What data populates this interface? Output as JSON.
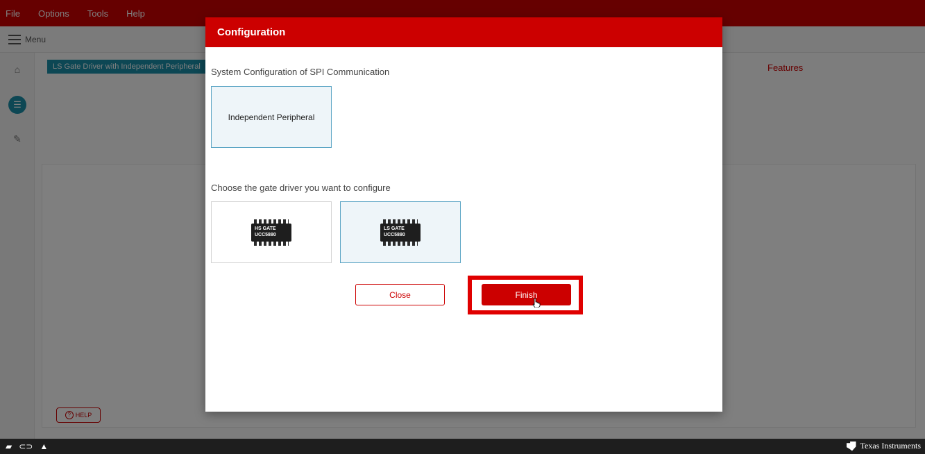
{
  "menubar": {
    "items": [
      "File",
      "Options",
      "Tools",
      "Help"
    ]
  },
  "toolbar": {
    "menu_label": "Menu"
  },
  "content": {
    "device_tab": "LS Gate Driver with Independent Peripheral",
    "features_tab": "Features",
    "help_label": "HELP"
  },
  "dialog": {
    "title": "Configuration",
    "section1_label": "System Configuration of SPI Communication",
    "option_independent": "Independent Peripheral",
    "section2_label": "Choose the gate driver you want to configure",
    "hs_chip": {
      "line1": "HS GATE",
      "line2": "UCC5880"
    },
    "ls_chip": {
      "line1": "LS GATE",
      "line2": "UCC5880"
    },
    "close_label": "Close",
    "finish_label": "Finish"
  },
  "statusbar": {
    "brand": "Texas Instruments"
  },
  "colors": {
    "accent": "#cc0000",
    "teal": "#1a8fa8",
    "selected_border": "#5aa4c4"
  },
  "icons": [
    "hamburger-icon",
    "home-icon",
    "settings-circle-icon",
    "pencil-icon",
    "question-icon",
    "book-icon",
    "code-icon",
    "chevron-up-icon",
    "ti-logo-icon",
    "hand-cursor-icon"
  ]
}
